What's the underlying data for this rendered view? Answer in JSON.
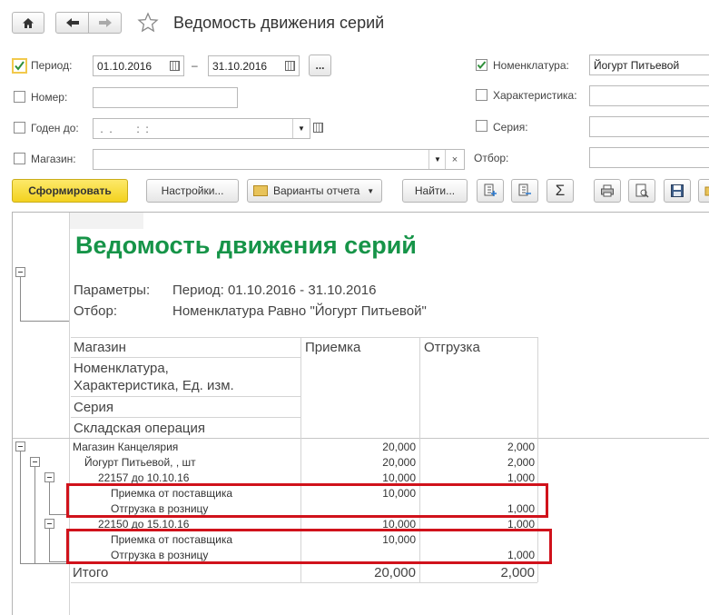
{
  "window": {
    "title": "Ведомость движения серий"
  },
  "filters": {
    "period_label": "Период:",
    "period_from": "01.10.2016",
    "period_dash": "–",
    "period_to": "31.10.2016",
    "period_more": "...",
    "number_label": "Номер:",
    "expiry_label": "Годен до:",
    "expiry_value": " .  .        :  :",
    "store_label": "Магазин:",
    "nomenclature_label": "Номенклатура:",
    "nomenclature_value": "Йогурт Питьевой",
    "characteristic_label": "Характеристика:",
    "series_label": "Серия:",
    "selection_label": "Отбор:"
  },
  "toolbar": {
    "generate": "Сформировать",
    "settings": "Настройки...",
    "variants": "Варианты отчета",
    "find": "Найти...",
    "sum_symbol": "Σ"
  },
  "report": {
    "title": "Ведомость движения серий",
    "params_label": "Параметры:",
    "params_value": "Период: 01.10.2016 - 31.10.2016",
    "filter_label": "Отбор:",
    "filter_value": "Номенклатура Равно \"Йогурт Питьевой\"",
    "headers": {
      "store": "Магазин",
      "nomenclature": "Номенклатура,",
      "nomenclature2": "Характеристика, Ед. изм.",
      "series": "Серия",
      "operation": "Складская операция",
      "receipt": "Приемка",
      "shipment": "Отгрузка"
    },
    "rows": [
      {
        "label": "Магазин Канцелярия",
        "receipt": "20,000",
        "shipment": "2,000"
      },
      {
        "label": "Йогурт Питьевой, , шт",
        "receipt": "20,000",
        "shipment": "2,000"
      },
      {
        "label": "22157 до 10.10.16",
        "receipt": "10,000",
        "shipment": "1,000"
      },
      {
        "label": "Приемка от поставщика",
        "receipt": "10,000",
        "shipment": ""
      },
      {
        "label": "Отгрузка в розницу",
        "receipt": "",
        "shipment": "1,000"
      },
      {
        "label": "22150 до 15.10.16",
        "receipt": "10,000",
        "shipment": "1,000"
      },
      {
        "label": "Приемка от поставщика",
        "receipt": "10,000",
        "shipment": ""
      },
      {
        "label": "Отгрузка в розницу",
        "receipt": "",
        "shipment": "1,000"
      }
    ],
    "total": {
      "label": "Итого",
      "receipt": "20,000",
      "shipment": "2,000"
    }
  }
}
